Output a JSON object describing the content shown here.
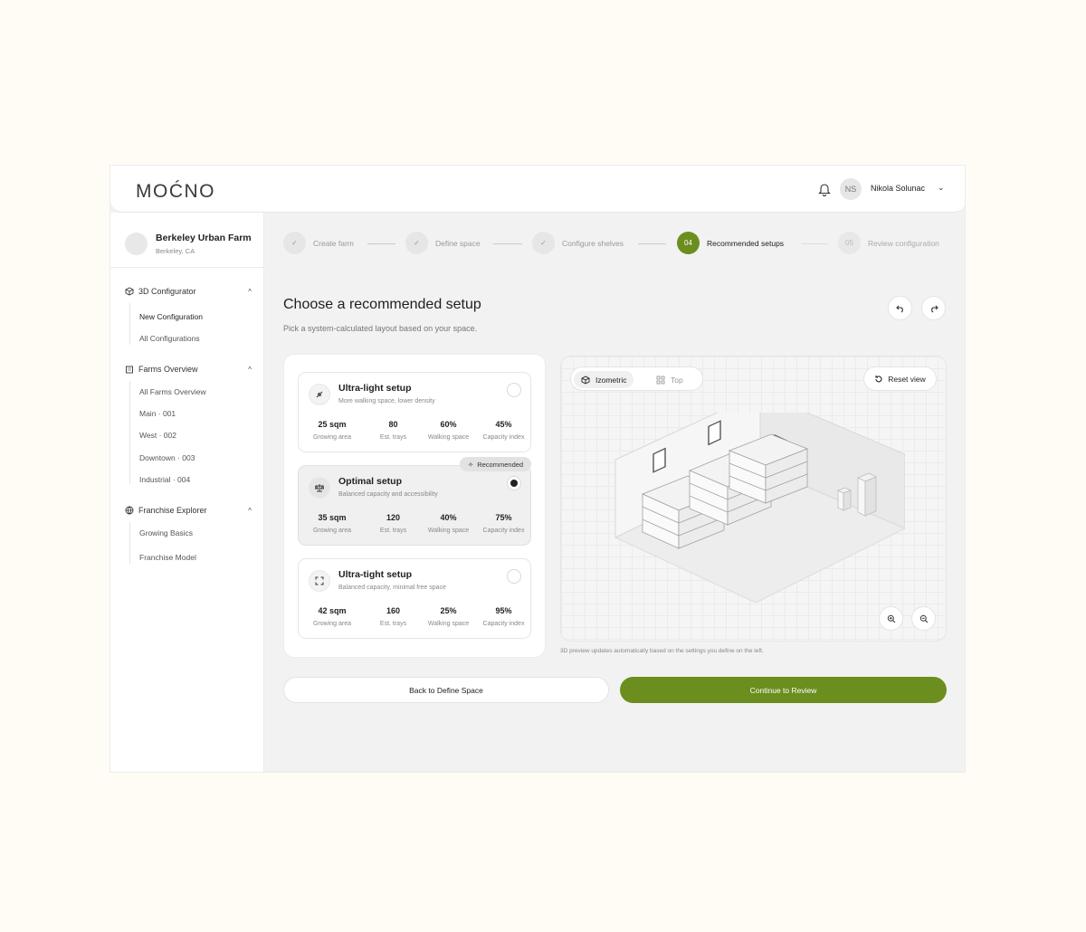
{
  "header": {
    "logo": "MOĆNO",
    "user_initials": "NS",
    "user_name": "Nikola Solunac"
  },
  "sidebar": {
    "farm_name": "Berkeley Urban Farm",
    "farm_location": "Berkeley, CA",
    "sections": [
      {
        "label": "3D Configurator",
        "items": [
          "New Configuration",
          "All Configurations"
        ]
      },
      {
        "label": "Farms Overview",
        "items": [
          "All Farms Overview",
          "Main · 001",
          "West · 002",
          "Downtown · 003",
          "Industrial · 004"
        ]
      },
      {
        "label": "Franchise Explorer",
        "items": [
          "Growing Basics",
          "Franchise Model"
        ]
      }
    ]
  },
  "stepper": {
    "steps": [
      {
        "num": "✓",
        "label": "Create farm"
      },
      {
        "num": "✓",
        "label": "Define space"
      },
      {
        "num": "✓",
        "label": "Configure shelves"
      },
      {
        "num": "04",
        "label": "Recommended setups"
      },
      {
        "num": "05",
        "label": "Review configuration"
      }
    ]
  },
  "page": {
    "title": "Choose a recommended setup",
    "subtitle": "Pick a system-calculated layout based on your space."
  },
  "setups": [
    {
      "title": "Ultra-light setup",
      "desc": "More walking space, lower density",
      "stats": [
        {
          "value": "25 sqm",
          "label": "Growing area"
        },
        {
          "value": "80",
          "label": "Est. trays"
        },
        {
          "value": "60%",
          "label": "Walking space"
        },
        {
          "value": "45%",
          "label": "Capacity index"
        }
      ]
    },
    {
      "title": "Optimal setup",
      "desc": "Balanced capacity and accessibility",
      "badge": "Recommended",
      "stats": [
        {
          "value": "35 sqm",
          "label": "Growing area"
        },
        {
          "value": "120",
          "label": "Est. trays"
        },
        {
          "value": "40%",
          "label": "Walking space"
        },
        {
          "value": "75%",
          "label": "Capacity index"
        }
      ]
    },
    {
      "title": "Ultra-tight setup",
      "desc": "Balanced capacity, minimal free space",
      "stats": [
        {
          "value": "42 sqm",
          "label": "Growing area"
        },
        {
          "value": "160",
          "label": "Est. trays"
        },
        {
          "value": "25%",
          "label": "Walking space"
        },
        {
          "value": "95%",
          "label": "Capacity index"
        }
      ]
    }
  ],
  "preview": {
    "view_isometric": "Izometric",
    "view_top": "Top",
    "reset_label": "Reset view",
    "note": "3D preview updates automatically based on the settings you define on the left."
  },
  "actions": {
    "back_label": "Back to Define Space",
    "continue_label": "Continue to Review"
  },
  "colors": {
    "accent": "#6b8e1e",
    "page_bg": "#fefcf4"
  }
}
